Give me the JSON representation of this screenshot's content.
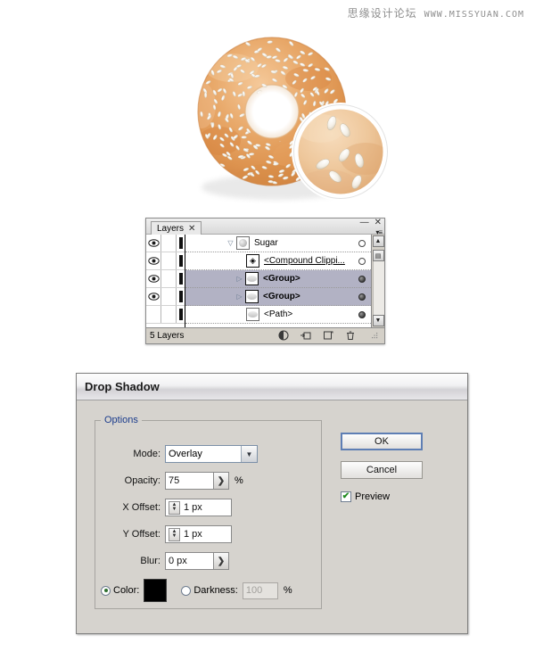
{
  "watermark": {
    "cn": "思缘设计论坛",
    "en": "WWW.MISSYUAN.COM"
  },
  "illustration": {
    "name": "sesame-bagel-with-magnifier",
    "description": "Sesame seed bagel illustration with circular zoom inset showing enlarged sesame seeds"
  },
  "layers_panel": {
    "tab_label": "Layers",
    "tab_close": "✕",
    "minimize": "—",
    "close": "✕",
    "menu": "▾≡",
    "footer_count": "5 Layers",
    "footer_icons": [
      {
        "name": "make-clipping-mask-icon",
        "glyph": "◒"
      },
      {
        "name": "create-new-sublayer-icon",
        "glyph": "⇥"
      },
      {
        "name": "create-new-layer-icon",
        "glyph": "❐"
      },
      {
        "name": "delete-selection-icon",
        "glyph": "🗑"
      }
    ],
    "scroll_up": "▲",
    "scroll_down": "▼",
    "scroll_extra": "▤",
    "rows": [
      {
        "name": "Sugar",
        "indent": 58,
        "visible": true,
        "locked": false,
        "selected": false,
        "bold": false,
        "underline": false,
        "has_disclosure": true,
        "disclosure": "▽",
        "thumb_type": "dot",
        "target_filled": false
      },
      {
        "name": "<Compound Clippi...",
        "indent": 82,
        "visible": true,
        "locked": false,
        "selected": false,
        "bold": false,
        "underline": true,
        "has_disclosure": false,
        "disclosure": "",
        "thumb_type": "clip",
        "target_filled": false
      },
      {
        "name": "<Group>",
        "indent": 68,
        "visible": true,
        "locked": false,
        "selected": true,
        "bold": true,
        "underline": false,
        "has_disclosure": true,
        "disclosure": "▷",
        "thumb_type": "blob",
        "target_filled": true
      },
      {
        "name": "<Group>",
        "indent": 68,
        "visible": true,
        "locked": false,
        "selected": true,
        "bold": true,
        "underline": false,
        "has_disclosure": true,
        "disclosure": "▷",
        "thumb_type": "blob",
        "target_filled": true
      },
      {
        "name": "<Path>",
        "indent": 82,
        "visible": false,
        "locked": false,
        "selected": false,
        "bold": false,
        "underline": false,
        "has_disclosure": false,
        "disclosure": "",
        "thumb_type": "blob",
        "target_filled": true
      }
    ]
  },
  "dialog": {
    "title": "Drop Shadow",
    "options_legend": "Options",
    "fields": {
      "mode_label": "Mode:",
      "mode_value": "Overlay",
      "opacity_label": "Opacity:",
      "opacity_value": "75",
      "opacity_unit": "%",
      "x_offset_label": "X Offset:",
      "x_offset_value": "1 px",
      "y_offset_label": "Y Offset:",
      "y_offset_value": "1 px",
      "blur_label": "Blur:",
      "blur_value": "0 px",
      "color_label": "Color:",
      "color_value": "#000000",
      "darkness_label": "Darkness:",
      "darkness_value": "100",
      "darkness_unit": "%"
    },
    "buttons": {
      "ok": "OK",
      "cancel": "Cancel",
      "preview": "Preview",
      "preview_checked": true,
      "preview_check_glyph": "✔"
    },
    "arrow_glyph": "❯",
    "chevron_glyph": "▼",
    "spinner_up": "▲",
    "spinner_down": "▼"
  },
  "colors": {
    "selection": "#b2b2c4",
    "legend_blue": "#1b3c8c",
    "default_button_border": "#5e7eb4",
    "check_green": "#1f8a1f",
    "panel_gray": "#d4d0c8",
    "dialog_gray": "#d6d3ce"
  }
}
